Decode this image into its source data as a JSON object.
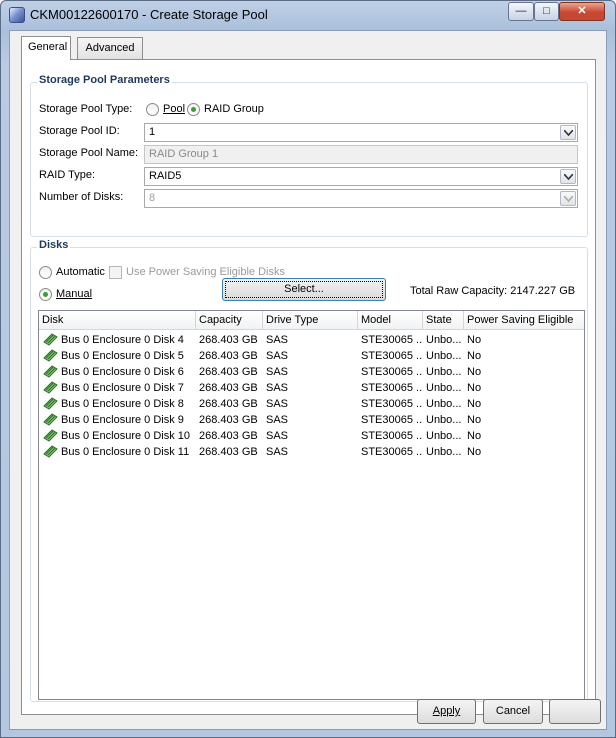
{
  "window": {
    "title": "CKM00122600170 - Create Storage Pool",
    "minimize": "—",
    "maximize": "□",
    "close": "✕"
  },
  "tabs": [
    "General",
    "Advanced"
  ],
  "params": {
    "legend": "Storage Pool Parameters",
    "pool_type_label": "Storage Pool Type:",
    "pool_option": "Pool",
    "raid_group_option": "RAID Group",
    "selected_type": "RAID Group",
    "id_label": "Storage Pool ID:",
    "id_value": "1",
    "name_label": "Storage Pool Name:",
    "name_value": "RAID Group 1",
    "raid_label": "RAID Type:",
    "raid_value": "RAID5",
    "num_disks_label": "Number of Disks:",
    "num_disks_value": "8"
  },
  "disks": {
    "legend": "Disks",
    "automatic_label": "Automatic",
    "power_saving_label": "Use Power Saving Eligible Disks",
    "manual_label": "Manual",
    "selected_mode": "Manual",
    "select_button": "Select...",
    "total_capacity": "Total Raw Capacity: 2147.227 GB",
    "columns": [
      "Disk",
      "Capacity",
      "Drive Type",
      "Model",
      "State",
      "Power Saving Eligible"
    ],
    "rows": [
      [
        "Bus 0 Enclosure 0 Disk 4",
        "268.403 GB",
        "SAS",
        "STE30065 ...",
        "Unbo...",
        "No"
      ],
      [
        "Bus 0 Enclosure 0 Disk 5",
        "268.403 GB",
        "SAS",
        "STE30065 ...",
        "Unbo...",
        "No"
      ],
      [
        "Bus 0 Enclosure 0 Disk 6",
        "268.403 GB",
        "SAS",
        "STE30065 ...",
        "Unbo...",
        "No"
      ],
      [
        "Bus 0 Enclosure 0 Disk 7",
        "268.403 GB",
        "SAS",
        "STE30065 ...",
        "Unbo...",
        "No"
      ],
      [
        "Bus 0 Enclosure 0 Disk 8",
        "268.403 GB",
        "SAS",
        "STE30065 ...",
        "Unbo...",
        "No"
      ],
      [
        "Bus 0 Enclosure 0 Disk 9",
        "268.403 GB",
        "SAS",
        "STE30065 ...",
        "Unbo...",
        "No"
      ],
      [
        "Bus 0 Enclosure 0 Disk 10",
        "268.403 GB",
        "SAS",
        "STE30065 ...",
        "Unbo...",
        "No"
      ],
      [
        "Bus 0 Enclosure 0 Disk 11",
        "268.403 GB",
        "SAS",
        "STE30065 ...",
        "Unbo...",
        "No"
      ]
    ]
  },
  "footer": {
    "apply": "Apply",
    "cancel": "Cancel"
  },
  "colors": {
    "legend_text": "#1e395b",
    "window_frame": "#b3c7e0",
    "radio_dot": "#3f9a3a",
    "disk_icon": "#3f8f37"
  },
  "icons": {
    "row_icon": "disk-drive-icon",
    "combo_arrow": "chevron-down-icon"
  }
}
